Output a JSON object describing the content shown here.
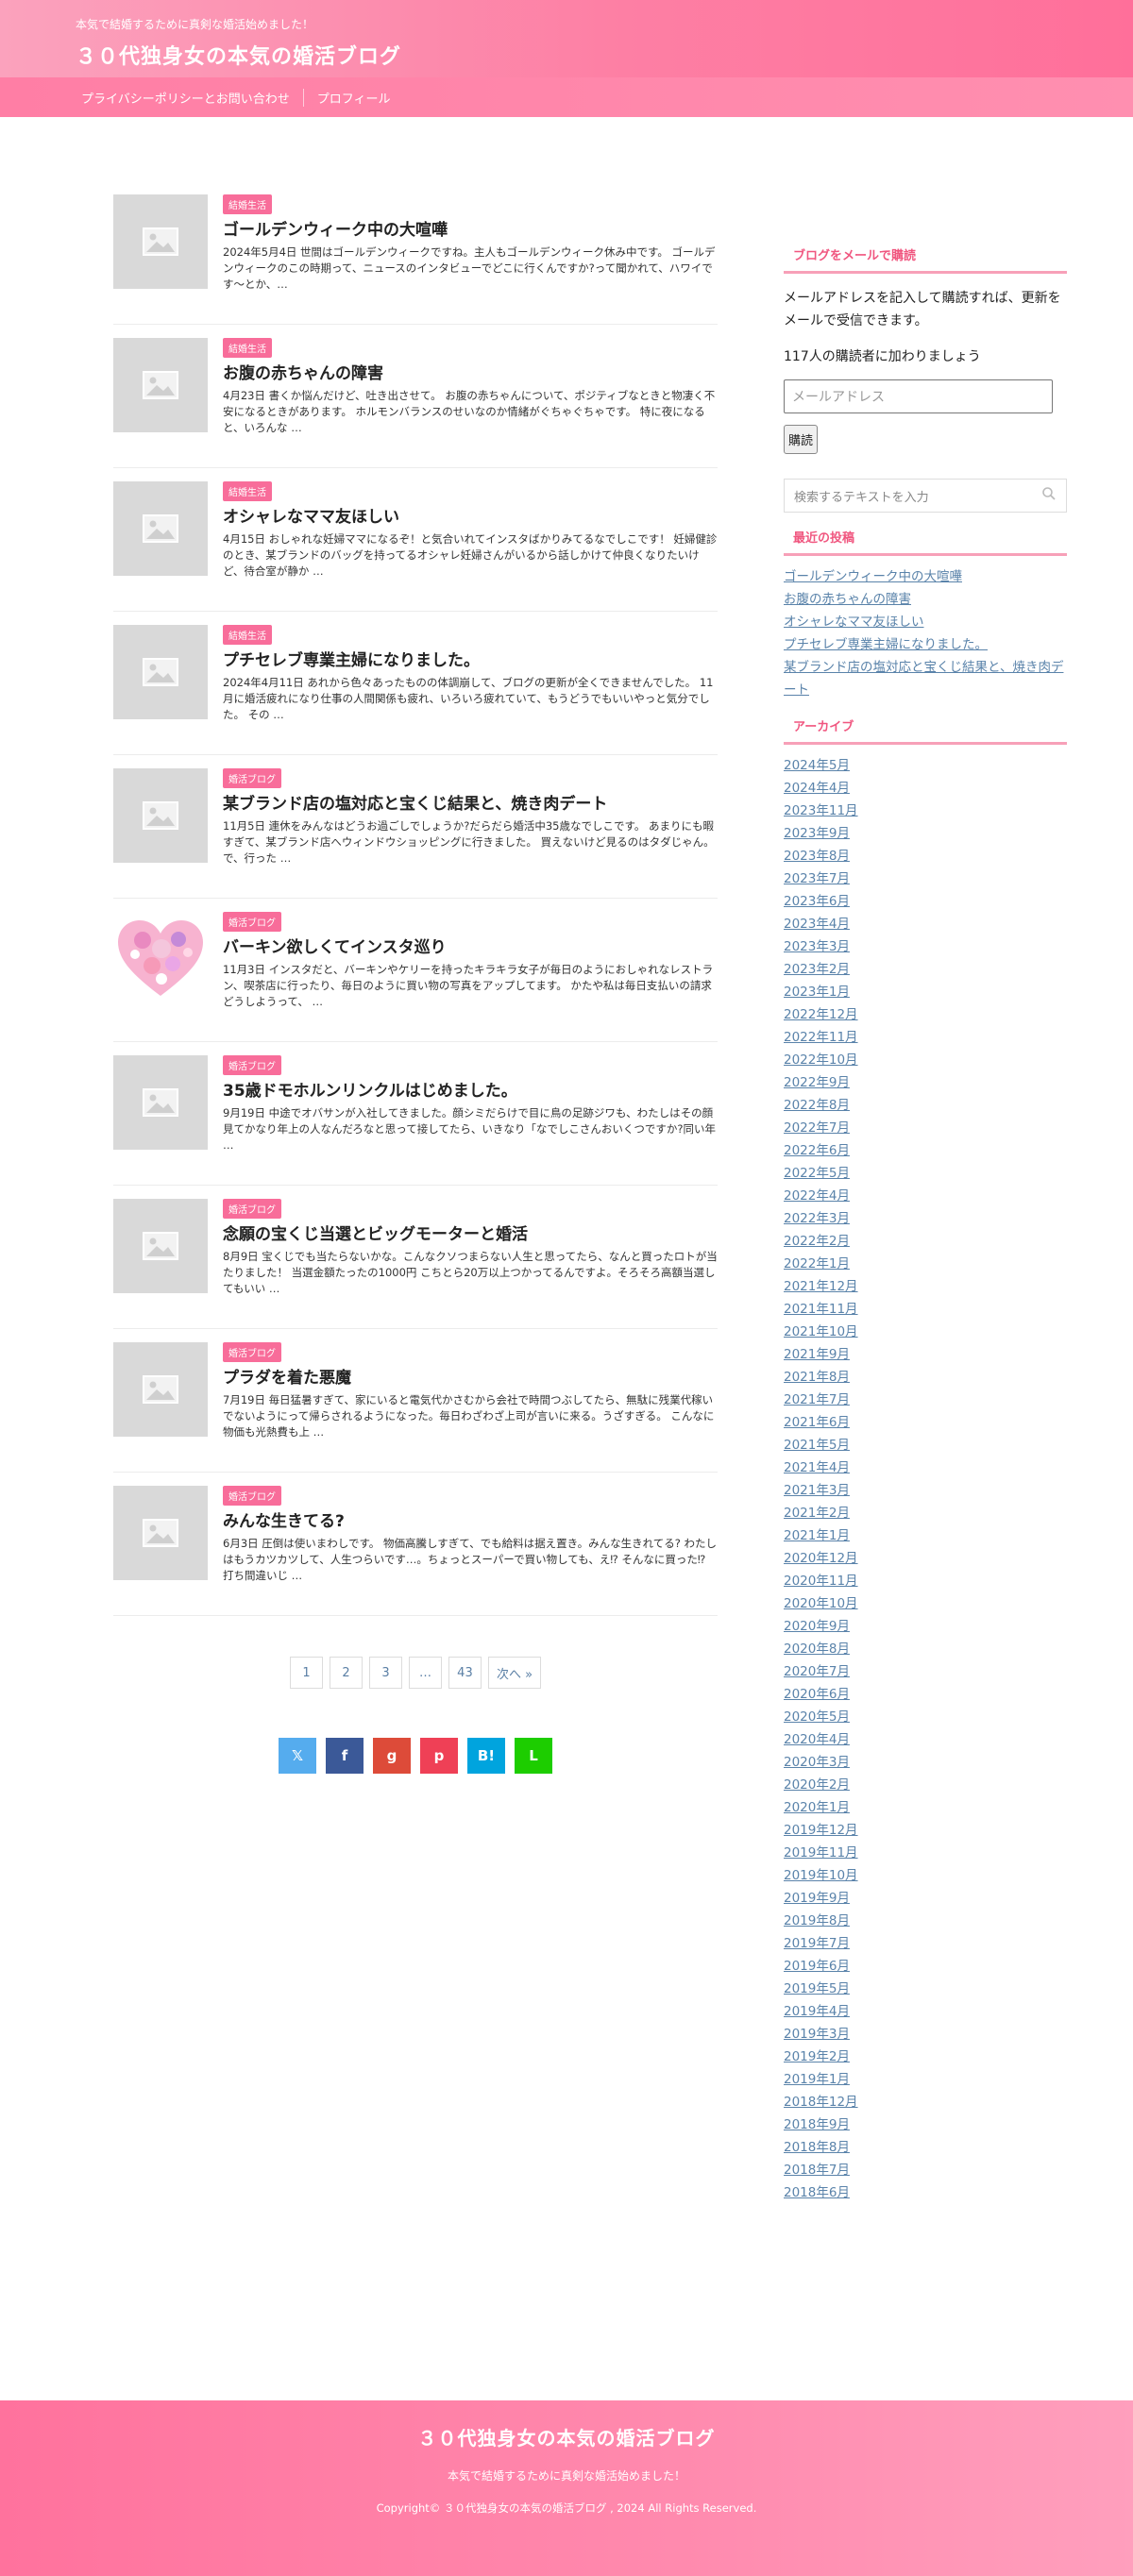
{
  "header": {
    "tagline": "本気で結婚するために真剣な婚活始めました！",
    "site_title": "３０代独身女の本気の婚活ブログ"
  },
  "nav": {
    "items": [
      {
        "label": "プライバシーポリシーとお問い合わせ"
      },
      {
        "label": "プロフィール"
      }
    ]
  },
  "posts": [
    {
      "category": "結婚生活",
      "title": "ゴールデンウィーク中の大喧嘩",
      "excerpt": "2024年5月4日 世間はゴールデンウィークですね。主人もゴールデンウィーク休み中です。 ゴールデンウィークのこの時期って、ニュースのインタビューでどこに行くんですか?って聞かれて、ハワイです〜とか、…",
      "thumb": "placeholder"
    },
    {
      "category": "結婚生活",
      "title": "お腹の赤ちゃんの障害",
      "excerpt": "4月23日 書くか悩んだけど、吐き出させて。 お腹の赤ちゃんについて、ポジティブなときと物凄く不安になるときがあります。 ホルモンバランスのせいなのか情緒がぐちゃぐちゃです。 特に夜になると、いろんな …",
      "thumb": "placeholder"
    },
    {
      "category": "結婚生活",
      "title": "オシャレなママ友ほしい",
      "excerpt": "4月15日 おしゃれな妊婦ママになるぞ！と気合いれてインスタばかりみてるなでしこです！ 妊婦健診のとき、某ブランドのバッグを持ってるオシャレ妊婦さんがいるから話しかけて仲良くなりたいけど、待合室が静か …",
      "thumb": "placeholder"
    },
    {
      "category": "結婚生活",
      "title": "プチセレブ専業主婦になりました。",
      "excerpt": "2024年4月11日 あれから色々あったものの体調崩して、ブログの更新が全くできませんでした。 11月に婚活疲れになり仕事の人間関係も疲れ、いろいろ疲れていて、もうどうでもいいやっと気分でした。 その …",
      "thumb": "placeholder"
    },
    {
      "category": "婚活ブログ",
      "title": "某ブランド店の塩対応と宝くじ結果と、焼き肉デート",
      "excerpt": "11月5日 連休をみんなはどうお過ごしでしょうか?だらだら婚活中35歳なでしこです。 あまりにも暇すぎて、某ブランド店へウィンドウショッピングに行きました。 買えないけど見るのはタダじゃん。 で、行った …",
      "thumb": "placeholder"
    },
    {
      "category": "婚活ブログ",
      "title": "バーキン欲しくてインスタ巡り",
      "excerpt": "11月3日 インスタだと、バーキンやケリーを持ったキラキラ女子が毎日のようにおしゃれなレストラン、喫茶店に行ったり、毎日のように買い物の写真をアップしてます。 かたや私は毎日支払いの請求どうしようって、 …",
      "thumb": "heart"
    },
    {
      "category": "婚活ブログ",
      "title": "35歳ドモホルンリンクルはじめました。",
      "excerpt": "9月19日  中途でオバサンが入社してきました。顔シミだらけで目に鳥の足跡ジワも、わたしはその顔見てかなり年上の人なんだろなと思って接してたら、いきなり「なでしこさんおいくつですか?同い年 …",
      "thumb": "placeholder"
    },
    {
      "category": "婚活ブログ",
      "title": "念願の宝くじ当選とビッグモーターと婚活",
      "excerpt": "8月9日 宝くじでも当たらないかな。こんなクソつまらない人生と思ってたら、なんと買ったロトが当たりました！ 当選金額たったの1000円 こちとら20万以上つかってるんですよ。そろそろ高額当選してもいい …",
      "thumb": "placeholder"
    },
    {
      "category": "婚活ブログ",
      "title": "プラダを着た悪魔",
      "excerpt": "7月19日 毎日猛暑すぎて、家にいると電気代かさむから会社で時間つぶしてたら、無駄に残業代稼いでないようにって帰らされるようになった。毎日わざわざ上司が言いに来る。うざすぎる。 こんなに物価も光熱費も上 …",
      "thumb": "placeholder"
    },
    {
      "category": "婚活ブログ",
      "title": "みんな生きてる?",
      "excerpt": "6月3日 圧倒は使いまわしです。 物価高騰しすぎて、でも給料は据え置き。みんな生きれてる? わたしはもうカツカツして、人生つらいです…。ちょっとスーパーで買い物しても、え⁉ そんなに買った⁉ 打ち間違いじ …",
      "thumb": "placeholder"
    }
  ],
  "pagination": {
    "pages": [
      "1",
      "2",
      "3",
      "…",
      "43"
    ],
    "next_label": "次へ »"
  },
  "share": {
    "buttons": [
      {
        "name": "twitter",
        "glyph": "𝕏",
        "color": "#55acee"
      },
      {
        "name": "facebook",
        "glyph": "f",
        "color": "#3b5998"
      },
      {
        "name": "googleplus",
        "glyph": "g",
        "color": "#dd4b39"
      },
      {
        "name": "pocket",
        "glyph": "p",
        "color": "#ef4056"
      },
      {
        "name": "hatena",
        "glyph": "B!",
        "color": "#00a4de"
      },
      {
        "name": "line",
        "glyph": "L",
        "color": "#1dcd00"
      }
    ]
  },
  "sidebar": {
    "email_widget": {
      "title": "ブログをメールで購読",
      "description": "メールアドレスを記入して購読すれば、更新をメールで受信できます。",
      "subscribers": "117人の購読者に加わりましょう",
      "placeholder": "メールアドレス",
      "button": "購読"
    },
    "search": {
      "placeholder": "検索するテキストを入力"
    },
    "recent": {
      "title": "最近の投稿",
      "items": [
        "ゴールデンウィーク中の大喧嘩",
        "お腹の赤ちゃんの障害",
        "オシャレなママ友ほしい",
        "プチセレブ専業主婦になりました。",
        "某ブランド店の塩対応と宝くじ結果と、焼き肉デート"
      ]
    },
    "archive": {
      "title": "アーカイブ",
      "items": [
        "2024年5月",
        "2024年4月",
        "2023年11月",
        "2023年9月",
        "2023年8月",
        "2023年7月",
        "2023年6月",
        "2023年4月",
        "2023年3月",
        "2023年2月",
        "2023年1月",
        "2022年12月",
        "2022年11月",
        "2022年10月",
        "2022年9月",
        "2022年8月",
        "2022年7月",
        "2022年6月",
        "2022年5月",
        "2022年4月",
        "2022年3月",
        "2022年2月",
        "2022年1月",
        "2021年12月",
        "2021年11月",
        "2021年10月",
        "2021年9月",
        "2021年8月",
        "2021年7月",
        "2021年6月",
        "2021年5月",
        "2021年4月",
        "2021年3月",
        "2021年2月",
        "2021年1月",
        "2020年12月",
        "2020年11月",
        "2020年10月",
        "2020年9月",
        "2020年8月",
        "2020年7月",
        "2020年6月",
        "2020年5月",
        "2020年4月",
        "2020年3月",
        "2020年2月",
        "2020年1月",
        "2019年12月",
        "2019年11月",
        "2019年10月",
        "2019年9月",
        "2019年8月",
        "2019年7月",
        "2019年6月",
        "2019年5月",
        "2019年4月",
        "2019年3月",
        "2019年2月",
        "2019年1月",
        "2018年12月",
        "2018年9月",
        "2018年8月",
        "2018年7月",
        "2018年6月"
      ]
    }
  },
  "footer": {
    "title": "３０代独身女の本気の婚活ブログ",
    "tagline": "本気で結婚するために真剣な婚活始めました！",
    "copyright": "Copyright©  ３０代独身女の本気の婚活ブログ , 2024 All  Rights Reserved."
  },
  "colors": {
    "accent": "#f86d9a",
    "link": "#5a83aa"
  }
}
